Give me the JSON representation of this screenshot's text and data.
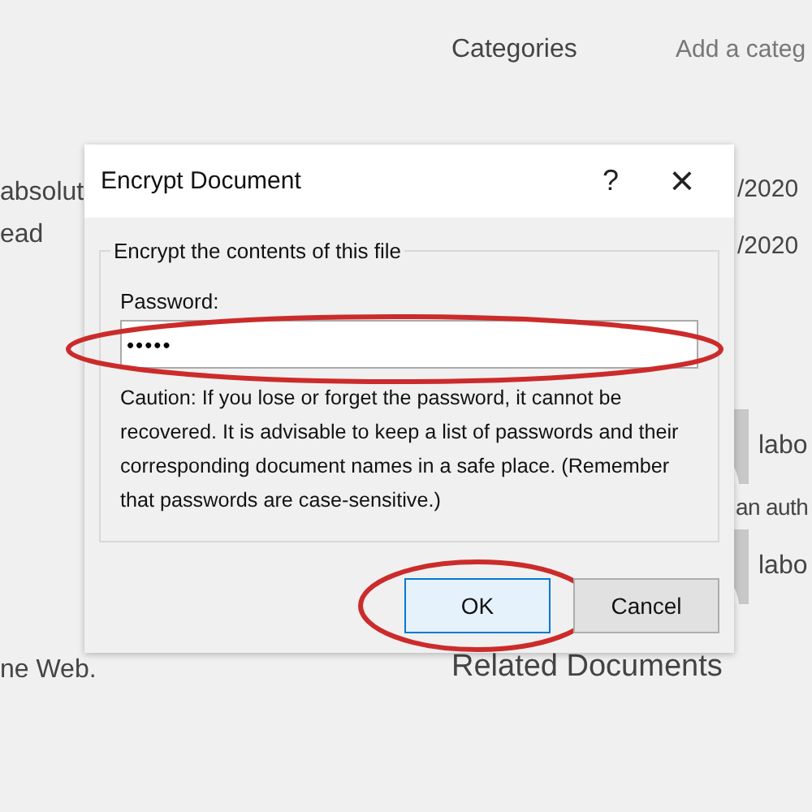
{
  "background": {
    "left_texts": [
      "absolut",
      "ead",
      "ne Web."
    ],
    "properties": [
      {
        "label": "Categories",
        "value": "Add a categ"
      }
    ],
    "dates": [
      "/2020",
      "/2020"
    ],
    "authors": [
      {
        "name": "labo"
      },
      {
        "name": "labo"
      }
    ],
    "author_hint": "an auth",
    "section": "Related Documents"
  },
  "dialog": {
    "title": "Encrypt Document",
    "help": "?",
    "close": "×",
    "group_label": "Encrypt the contents of this file",
    "password_label": "Password:",
    "password_value": "•••••",
    "password_highlighted": true,
    "caution": "Caution: If you lose or forget the password, it cannot be recovered. It is advisable to keep a list of passwords and their corresponding document names in a safe place. (Remember that passwords are case-sensitive.)",
    "buttons": [
      {
        "label": "OK",
        "default": true,
        "highlighted": true
      },
      {
        "label": "Cancel",
        "default": false,
        "highlighted": false
      }
    ]
  }
}
